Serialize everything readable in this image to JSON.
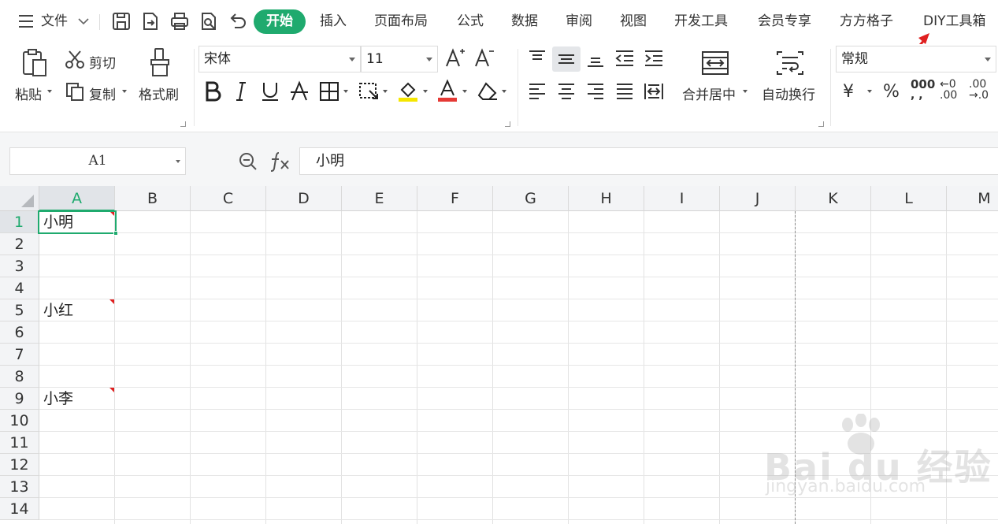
{
  "menubar": {
    "file_label": "文件",
    "tabs": [
      {
        "label": "开始",
        "active": true
      },
      {
        "label": "插入"
      },
      {
        "label": "页面布局"
      },
      {
        "label": "公式"
      },
      {
        "label": "数据"
      },
      {
        "label": "审阅"
      },
      {
        "label": "视图"
      },
      {
        "label": "开发工具"
      },
      {
        "label": "会员专享"
      },
      {
        "label": "方方格子"
      },
      {
        "label": "DIY工具箱"
      }
    ]
  },
  "ribbon": {
    "clipboard": {
      "paste": "粘贴",
      "cut": "剪切",
      "copy": "复制",
      "format_painter": "格式刷"
    },
    "font": {
      "name": "宋体",
      "size": "11",
      "font_color": "#e53935",
      "fill_color": "#f5e600"
    },
    "alignment": {
      "merge_center": "合并居中",
      "wrap_text": "自动换行"
    },
    "number": {
      "format": "常规",
      "currency": "¥",
      "percent": "%",
      "thousands": "000",
      "inc_decimal_top": "←0",
      "inc_decimal_bottom": ".00",
      "dec_decimal_top": ".00",
      "dec_decimal_bottom": "→.0"
    }
  },
  "formula_bar": {
    "name_box": "A1",
    "content": "小明"
  },
  "sheet": {
    "columns": [
      "A",
      "B",
      "C",
      "D",
      "E",
      "F",
      "G",
      "H",
      "I",
      "J",
      "K",
      "L",
      "M"
    ],
    "rows": [
      "1",
      "2",
      "3",
      "4",
      "5",
      "6",
      "7",
      "8",
      "9",
      "10",
      "11",
      "12",
      "13",
      "14"
    ],
    "cells": {
      "A1": "小明",
      "A5": "小红",
      "A9": "小李"
    },
    "selected": "A1",
    "accent": "#1faa6e"
  },
  "watermark": {
    "brand": "Bai du 经验",
    "url": "jingyan.baidu.com"
  }
}
